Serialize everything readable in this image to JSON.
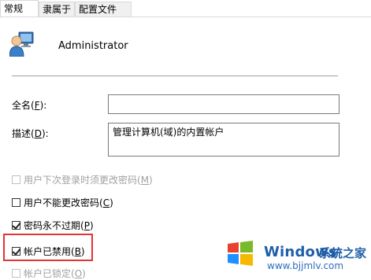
{
  "tabs": [
    {
      "label": "常规"
    },
    {
      "label": "隶属于"
    },
    {
      "label": "配置文件"
    }
  ],
  "user": {
    "name": "Administrator"
  },
  "fields": {
    "fullname": {
      "label": "全名(",
      "key": "F",
      "end": "):",
      "value": ""
    },
    "description": {
      "label": "描述(",
      "key": "D",
      "end": "):",
      "value": "管理计算机(域)的内置帐户"
    }
  },
  "checkboxes": [
    {
      "label": "用户下次登录时须更改密码(",
      "key": "M",
      "end": ")",
      "checked": false,
      "disabled": true
    },
    {
      "label": "用户不能更改密码(",
      "key": "C",
      "end": ")",
      "checked": false,
      "disabled": false
    },
    {
      "label": "密码永不过期(",
      "key": "P",
      "end": ")",
      "checked": true,
      "disabled": false
    },
    {
      "label": "帐户已禁用(",
      "key": "B",
      "end": ")",
      "checked": true,
      "disabled": false
    },
    {
      "label": "帐户已锁定(",
      "key": "O",
      "end": ")",
      "checked": false,
      "disabled": true
    }
  ],
  "watermark": {
    "brand": "Windows",
    "site": "系统之家",
    "url": "www.bjjmlv.com"
  },
  "colors": {
    "highlight": "#e53333",
    "watermark": "#1f5fa8"
  }
}
